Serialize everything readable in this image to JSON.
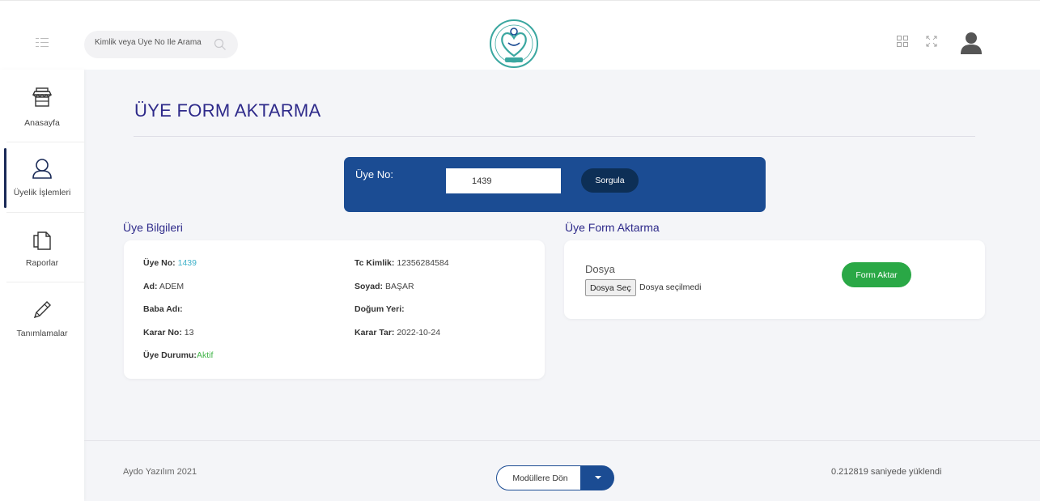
{
  "header": {
    "search_placeholder": "Kimlik veya Üye No İle Arama"
  },
  "sidebar": {
    "items": [
      {
        "label": "Anasayfa"
      },
      {
        "label": "Üyelik İşlemleri"
      },
      {
        "label": "Raporlar"
      },
      {
        "label": "Tanımlamalar"
      }
    ]
  },
  "page": {
    "title": "ÜYE FORM AKTARMA"
  },
  "query": {
    "label": "Üye No:",
    "value": "1439",
    "button": "Sorgula"
  },
  "member_info": {
    "section_title": "Üye Bilgileri",
    "fields": [
      {
        "label": "Üye No:",
        "value": "1439"
      },
      {
        "label": "Tc Kimlik:",
        "value": "12356284584"
      },
      {
        "label": "Ad:",
        "value": "ADEM"
      },
      {
        "label": "Soyad:",
        "value": "BAŞAR"
      },
      {
        "label": "Baba Adı:",
        "value": ""
      },
      {
        "label": "Doğum Yeri:",
        "value": ""
      },
      {
        "label": "Karar No:",
        "value": "13"
      },
      {
        "label": "Karar Tar:",
        "value": "2022-10-24"
      },
      {
        "label": "Üye Durumu:",
        "value": "Aktif"
      }
    ]
  },
  "form_transfer": {
    "section_title": "Üye Form Aktarma",
    "file_label": "Dosya",
    "file_button": "Dosya Seç",
    "file_status": "Dosya seçilmedi",
    "submit": "Form Aktar"
  },
  "footer": {
    "copyright": "Aydo Yazılım 2021",
    "modules_button": "Modüllere Dön",
    "load_time": "0.212819 saniyede yüklendi"
  },
  "colors": {
    "primary": "#1b4c93",
    "title": "#2e2a8a",
    "success": "#2aa846",
    "link": "#3fb1c9",
    "status_active": "#42b549"
  }
}
